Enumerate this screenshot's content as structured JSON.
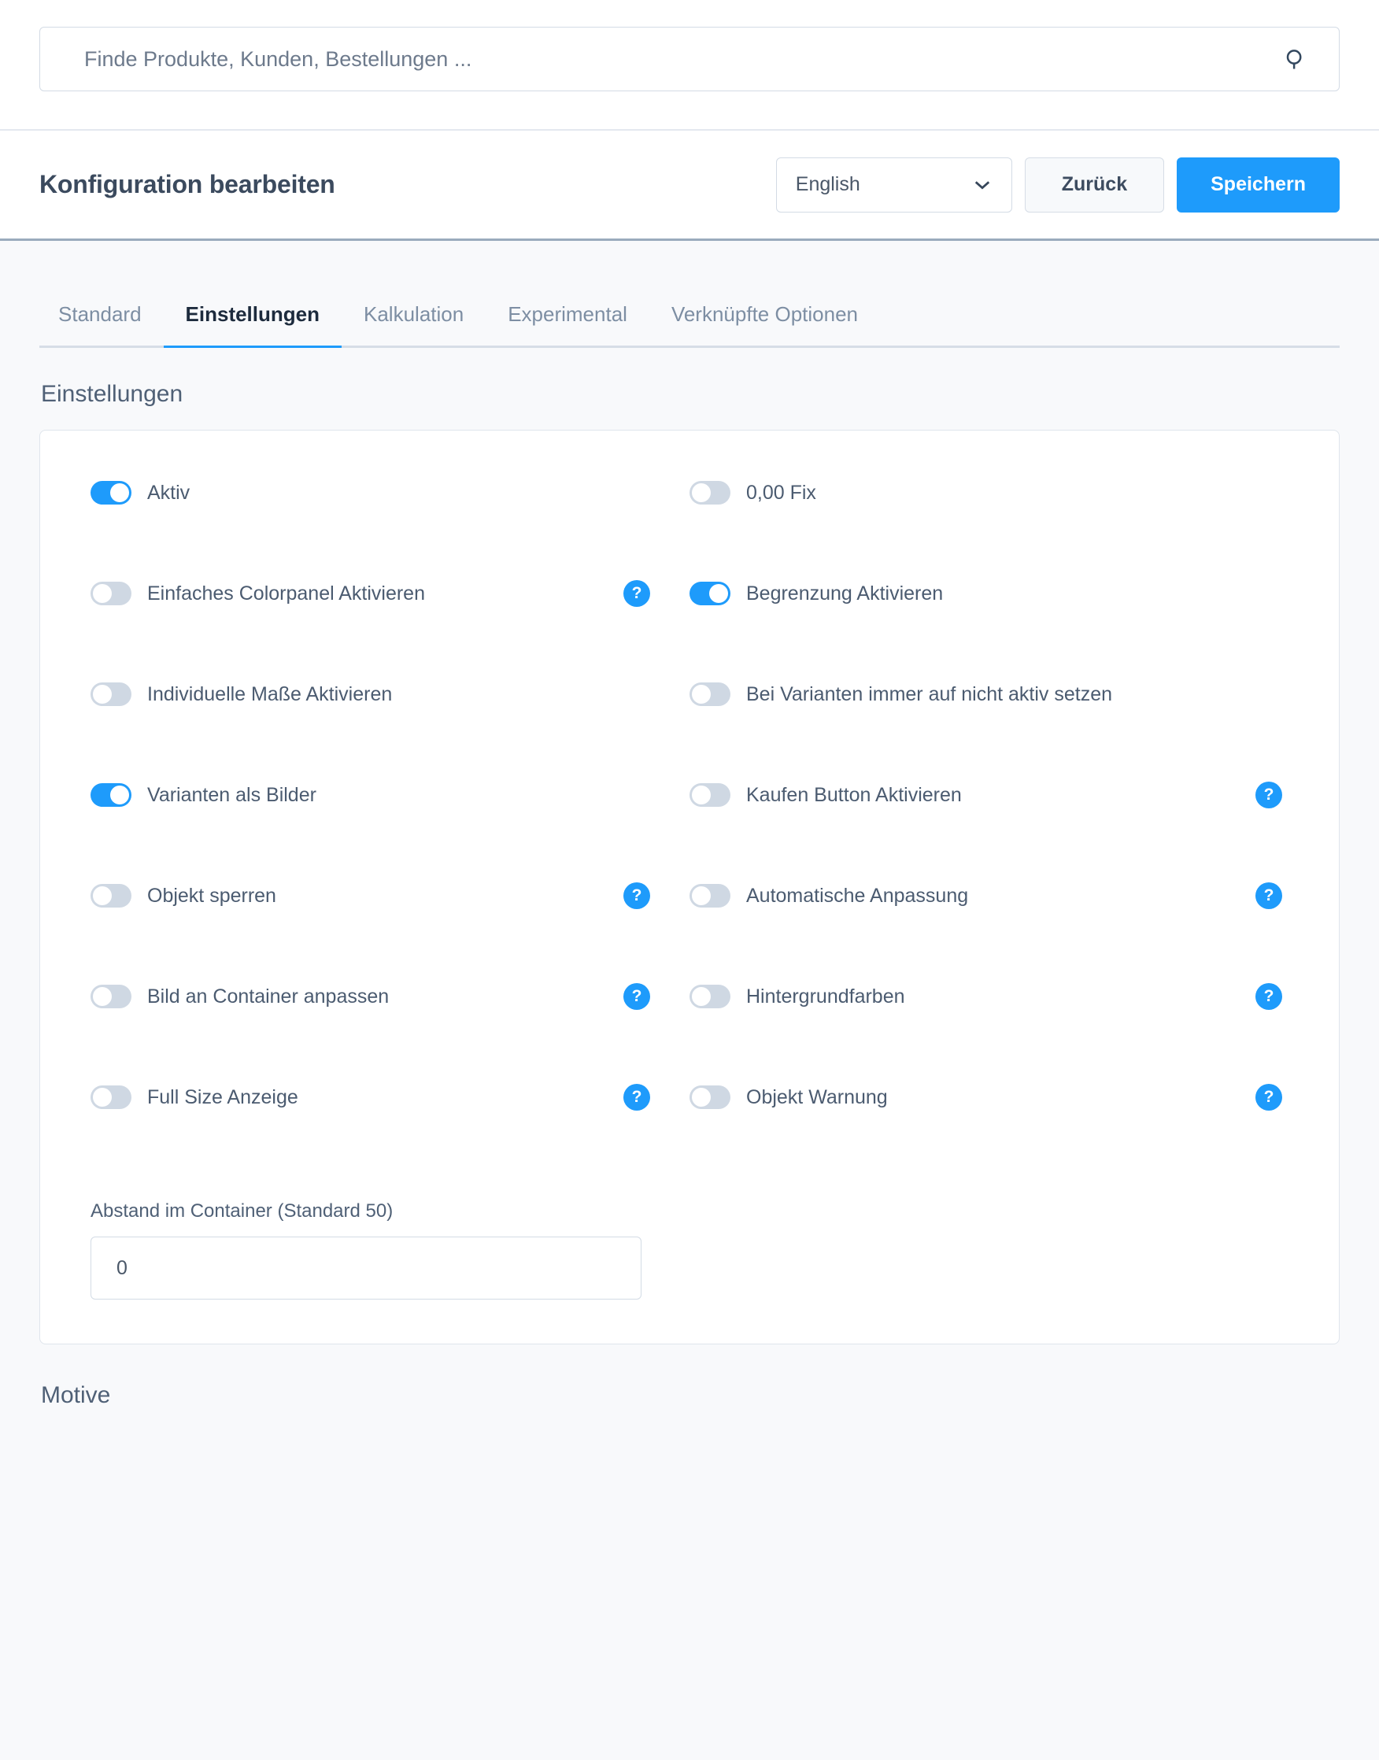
{
  "search": {
    "placeholder": "Finde Produkte, Kunden, Bestellungen ...",
    "icon": "search-icon"
  },
  "header": {
    "title": "Konfiguration bearbeiten",
    "language_value": "English",
    "back_label": "Zurück",
    "save_label": "Speichern"
  },
  "tabs": [
    {
      "label": "Standard",
      "active": false
    },
    {
      "label": "Einstellungen",
      "active": true
    },
    {
      "label": "Kalkulation",
      "active": false
    },
    {
      "label": "Experimental",
      "active": false
    },
    {
      "label": "Verknüpfte Optionen",
      "active": false
    }
  ],
  "section": {
    "heading": "Einstellungen"
  },
  "toggle_rows": [
    {
      "left": {
        "label": "Aktiv",
        "on": true,
        "help": false
      },
      "right": {
        "label": "0,00 Fix",
        "on": false,
        "help": false
      }
    },
    {
      "left": {
        "label": "Einfaches Colorpanel Aktivieren",
        "on": false,
        "help": true
      },
      "right": {
        "label": "Begrenzung Aktivieren",
        "on": true,
        "help": false
      }
    },
    {
      "left": {
        "label": "Individuelle Maße Aktivieren",
        "on": false,
        "help": false
      },
      "right": {
        "label": "Bei Varianten immer auf nicht aktiv setzen",
        "on": false,
        "help": false
      }
    },
    {
      "left": {
        "label": "Varianten als Bilder",
        "on": true,
        "help": false
      },
      "right": {
        "label": "Kaufen Button Aktivieren",
        "on": false,
        "help": true
      }
    },
    {
      "left": {
        "label": "Objekt sperren",
        "on": false,
        "help": true
      },
      "right": {
        "label": "Automatische Anpassung",
        "on": false,
        "help": true
      }
    },
    {
      "left": {
        "label": "Bild an Container anpassen",
        "on": false,
        "help": true
      },
      "right": {
        "label": "Hintergrundfarben",
        "on": false,
        "help": true
      }
    },
    {
      "left": {
        "label": "Full Size Anzeige",
        "on": false,
        "help": true
      },
      "right": {
        "label": "Objekt Warnung",
        "on": false,
        "help": true
      }
    }
  ],
  "spacing_field": {
    "label": "Abstand im Container (Standard 50)",
    "value": "0"
  },
  "bottom_section": {
    "heading": "Motive"
  },
  "colors": {
    "accent": "#1e9bfb",
    "toggle_off": "#cfd8e3",
    "text": "#4b5b70",
    "page_bg": "#f8f9fb"
  },
  "help_icon_glyph": "?"
}
